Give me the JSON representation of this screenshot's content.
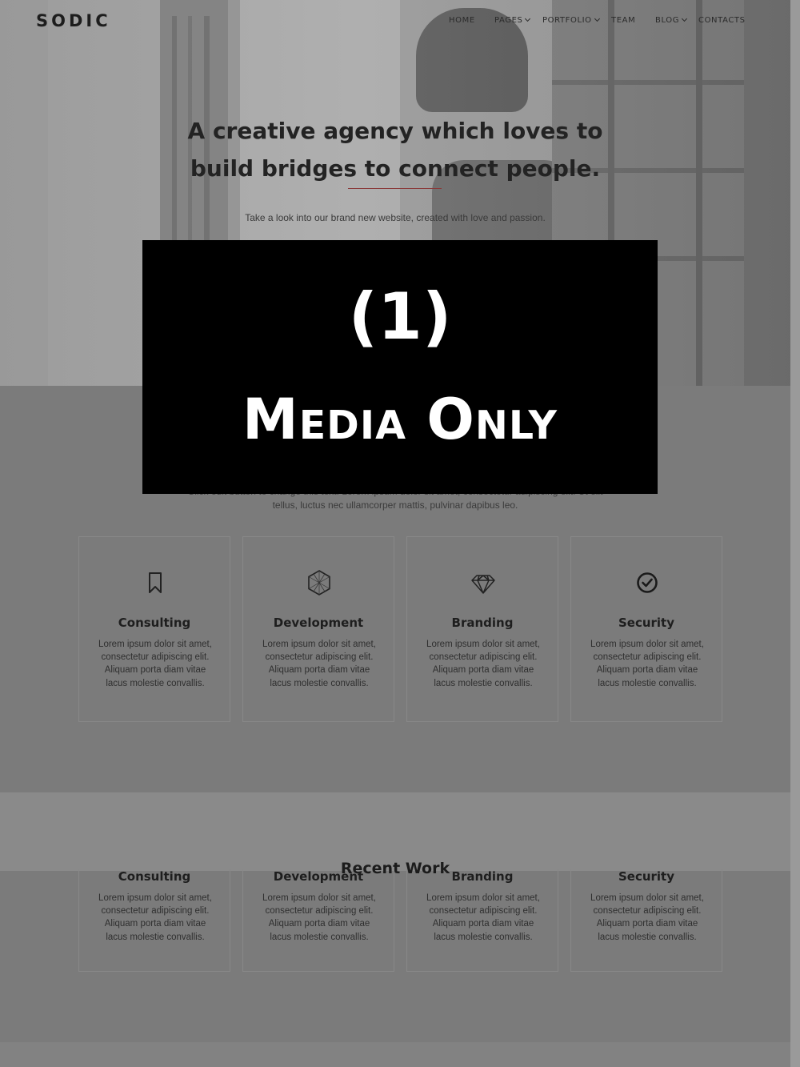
{
  "header": {
    "logo": "SODIC",
    "nav": [
      {
        "label": "HOME",
        "has_dropdown": false
      },
      {
        "label": "PAGES",
        "has_dropdown": true
      },
      {
        "label": "PORTFOLIO",
        "has_dropdown": true
      },
      {
        "label": "TEAM",
        "has_dropdown": false
      },
      {
        "label": "BLOG",
        "has_dropdown": true
      },
      {
        "label": "CONTACTS",
        "has_dropdown": false
      }
    ]
  },
  "hero": {
    "title_line1": "A creative agency which loves to",
    "title_line2": "build bridges to connect people.",
    "subtitle": "Take a look into our brand new website, created with love and passion."
  },
  "intro": {
    "line1": "Click edit button to change this text. Lorem ipsum dolor sit amet, consectetur adipiscing elit. Ut elit",
    "line2": "tellus, luctus nec ullamcorper mattis, pulvinar dapibus leo."
  },
  "services": [
    {
      "icon": "bookmark-icon",
      "title": "Consulting",
      "text": [
        "Lorem ipsum dolor sit amet,",
        "consectetur adipiscing elit.",
        "Aliquam porta diam vitae",
        "lacus molestie convallis."
      ]
    },
    {
      "icon": "hexagon-mesh-icon",
      "title": "Development",
      "text": [
        "Lorem ipsum dolor sit amet,",
        "consectetur adipiscing elit.",
        "Aliquam porta diam vitae",
        "lacus molestie convallis."
      ]
    },
    {
      "icon": "diamond-icon",
      "title": "Branding",
      "text": [
        "Lorem ipsum dolor sit amet,",
        "consectetur adipiscing elit.",
        "Aliquam porta diam vitae",
        "lacus molestie convallis."
      ]
    },
    {
      "icon": "check-circle-icon",
      "title": "Security",
      "text": [
        "Lorem ipsum dolor sit amet,",
        "consectetur adipiscing elit.",
        "Aliquam porta diam vitae",
        "lacus molestie convallis."
      ]
    }
  ],
  "recent_work": {
    "heading": "Recent Work"
  },
  "overlay": {
    "line1": "(1)",
    "line2": "Media Only"
  },
  "colors": {
    "overlay_bg": "#000000",
    "hero_rule": "#8a3a3a",
    "page_dim": "#7b7b7b"
  }
}
